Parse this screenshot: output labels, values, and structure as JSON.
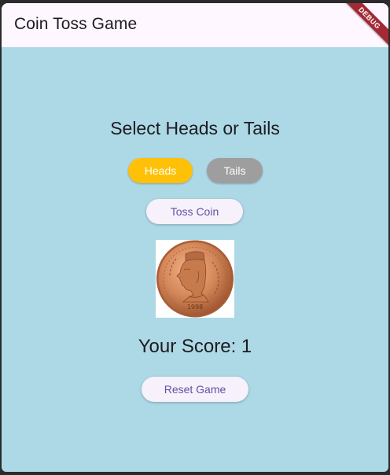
{
  "appbar": {
    "title": "Coin Toss Game",
    "debug_banner": "DEBUG"
  },
  "main": {
    "heading": "Select Heads or Tails",
    "choices": [
      {
        "label": "Heads",
        "color": "#ffc107",
        "selected": true
      },
      {
        "label": "Tails",
        "color": "#9e9e9e",
        "selected": false
      }
    ],
    "toss_button_label": "Toss Coin",
    "coin_image": {
      "icon": "coin-image",
      "year": "1998"
    },
    "score_text": "Your Score: 1",
    "reset_button_label": "Reset Game"
  },
  "colors": {
    "background": "#add8e6",
    "appbar": "#fef7ff",
    "button_text": "#6750a4"
  }
}
